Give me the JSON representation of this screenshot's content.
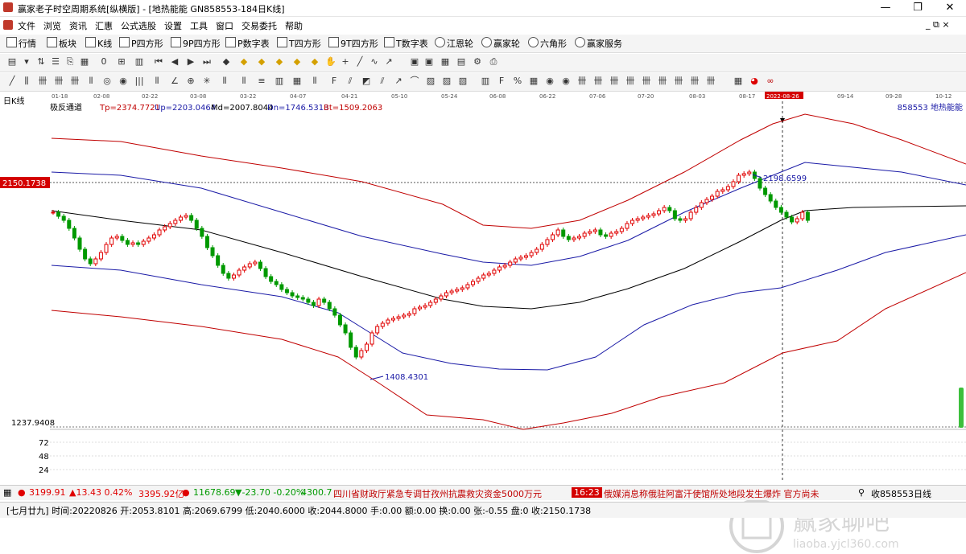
{
  "window": {
    "title": "赢家老子时空周期系统[纵横版] - [地热能能  GN858553-184日K线]",
    "controls": {
      "minimize": "—",
      "maximize": "❐",
      "close": "✕"
    }
  },
  "menu": {
    "items": [
      "文件",
      "浏览",
      "资讯",
      "汇惠",
      "公式选股",
      "设置",
      "工具",
      "窗口",
      "交易委托",
      "帮助"
    ],
    "mdi_controls": "_ ⧉ ×"
  },
  "toolbar1": {
    "buttons": [
      "行情",
      "板块",
      "K线",
      "P四方形",
      "9P四方形",
      "P数字表",
      "T四方形",
      "9T四方形",
      "T数字表",
      "江恩轮",
      "赢家轮",
      "六角形",
      "赢家服务"
    ]
  },
  "chart": {
    "period_label": "日K线",
    "indicator_name": "极反通道",
    "tp": "Tp=2374.7721",
    "up": "Up=2203.0464",
    "md": "Md=2007.8044",
    "dn": "Dn=1746.5313",
    "bt": "Bt=1509.2063",
    "stock_code_name": "858553  地热能能",
    "dates": [
      "01-18",
      "02-08",
      "02-22",
      "03-08",
      "03-22",
      "04-07",
      "04-21",
      "05-10",
      "05-24",
      "06-08",
      "06-22",
      "07-06",
      "07-20",
      "08-03",
      "08-17",
      "2022-08-26",
      "09-14",
      "09-28",
      "10-12"
    ],
    "price_label": "2150.1738",
    "bottom_label": "1237.9408",
    "high_annotation": "2198.6599",
    "low_annotation": "1408.4301",
    "volume_labels": [
      "72",
      "48",
      "24"
    ],
    "colors": {
      "up": "#e00000",
      "down": "#009900",
      "outer": "#c00000",
      "inner": "#1a1aa6",
      "mid": "#000000"
    }
  },
  "watermark": {
    "brand": "赢家聊吧",
    "url": "liaoba.yjcl360.com"
  },
  "status1": {
    "sh_index": "3199.91",
    "sh_change": "▲13.43 0.42%",
    "sh_amount": "3395.92亿",
    "sz_index": "11678.69",
    "sz_change": "▼-23.70 -0.20%",
    "sz_amount": "4300.7",
    "news1": "四川省财政厅紧急专调甘孜州抗震救灾资金5000万元",
    "news_time": "16:23",
    "news2": "俄媒消息称俄驻阿富汗使馆所处地段发生爆炸 官方尚未",
    "subscribe": "收858553日线"
  },
  "status2": {
    "info": "[七月廿九] 时间:20220826 开:2053.8101 高:2069.6799 低:2040.6000 收:2044.8000 手:0.00 额:0.00 换:0.00 张:-0.55 盘:0 收:2150.1738"
  }
}
